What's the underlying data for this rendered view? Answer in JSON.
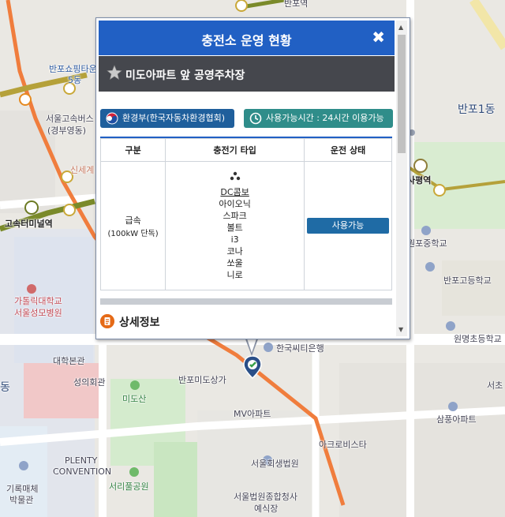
{
  "popup": {
    "title": "충전소 운영 현황",
    "close_label": "✖",
    "station_name": "미도아파트 앞 공영주차장",
    "operator_label": "환경부(한국자동차환경협회)",
    "hours_label": "사용가능시간 : 24시간 이용가능",
    "table": {
      "headers": [
        "구분",
        "충전기 타입",
        "운전 상태"
      ],
      "speed_label": "급속",
      "speed_detail": "(100kW 단독)",
      "charger_types": [
        "DC콤보",
        "아이오닉",
        "스파크",
        "볼트",
        "i3",
        "코나",
        "쏘울",
        "니로"
      ],
      "status_button": "사용가능"
    },
    "detail_label": "상세정보"
  },
  "map": {
    "labels": {
      "banpo_shopping": "반포쇼핑타운",
      "dong5": "5동",
      "seoul_terminal": "서울고속버스",
      "gyeongbu": "(경부영동)",
      "sinsegye": "신세계",
      "express_terminal": "고속터미널역",
      "catholic_univ": "가톨릭대학교",
      "st_mary": "서울성모병원",
      "daehak": "대학본관",
      "seongui": "성의회관",
      "plenty": "PLENTY",
      "convention": "CONVENTION",
      "gireok": "기록매체",
      "museum": "박물관",
      "seorae_park": "서리풀공원",
      "midosan": "미도산",
      "banpo_mido_mall": "반포미도상가",
      "mv_apt": "MV아파트",
      "citibank": "한국씨티은행",
      "acro_vista": "아크로비스타",
      "seoul_court": "서울회생법원",
      "seoul_court2": "서울법원종합청사",
      "arts_center": "예식장",
      "banpo1": "반포1동",
      "sapyeong": "사평역",
      "banpo_mid": "원포중학교",
      "banpo_high": "반포고등학교",
      "wonmyeong": "원명초등학교",
      "sampung": "삼풍아파트",
      "seocho": "서초",
      "dong": "동",
      "banpo_top": "반포역"
    }
  }
}
